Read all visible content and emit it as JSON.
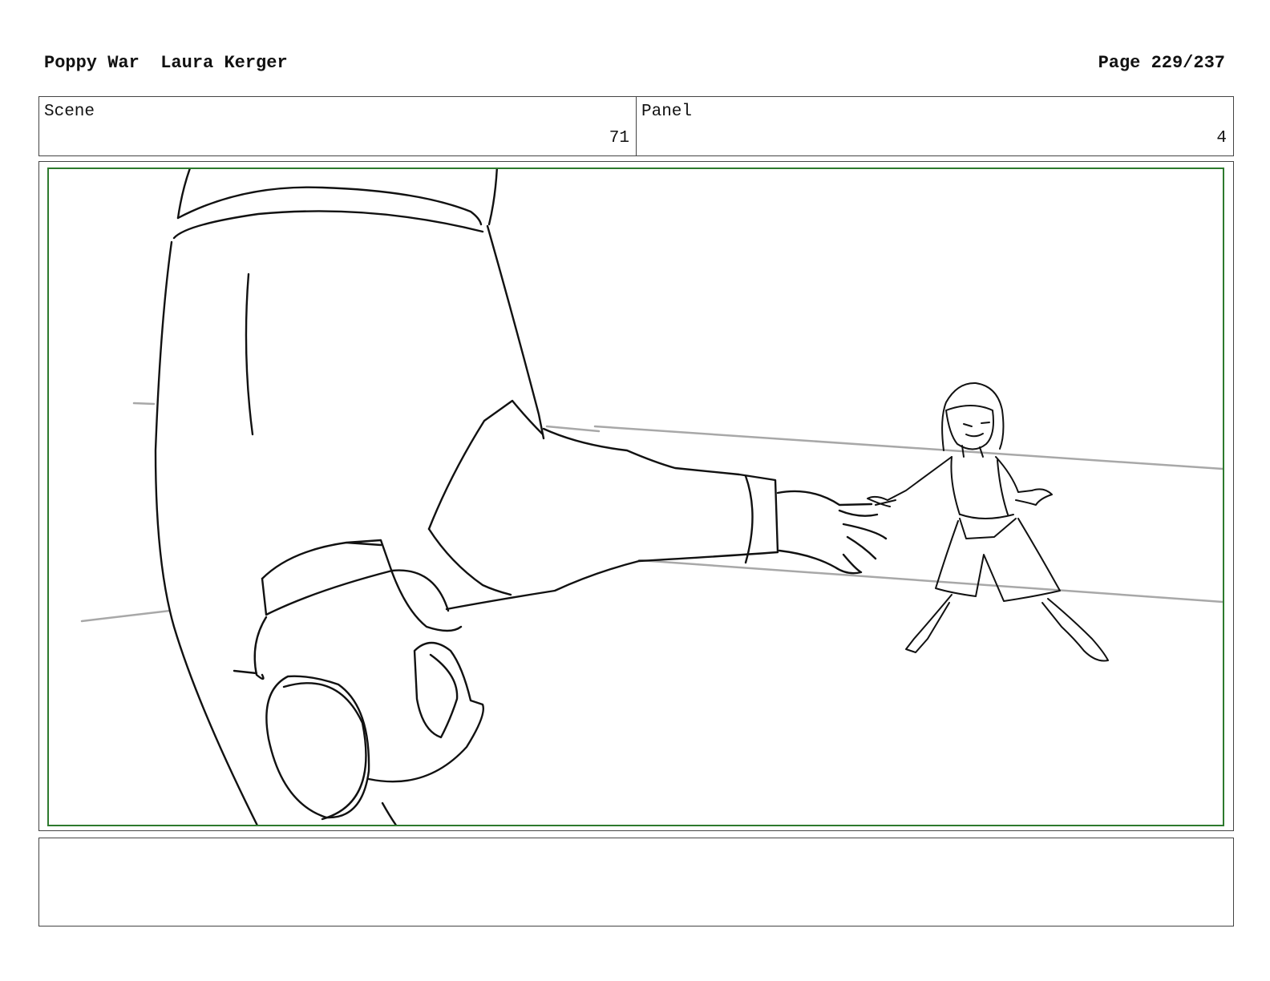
{
  "header": {
    "project": "Poppy War",
    "artist": "Laura Kerger",
    "page": "Page 229/237"
  },
  "scene": {
    "label": "Scene",
    "number": "71"
  },
  "panel": {
    "label": "Panel",
    "number": "4"
  },
  "notes": {
    "text": ""
  },
  "colors": {
    "safe_frame": "#2d7a2d",
    "border": "#444444",
    "pencil": "#111111",
    "floor_line": "#a8a8a8"
  }
}
